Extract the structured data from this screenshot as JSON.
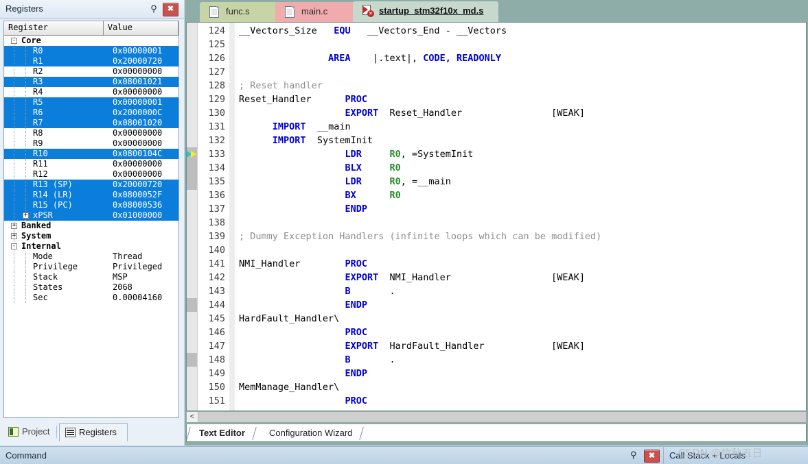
{
  "registers_panel": {
    "title": "Registers",
    "pin_icon": "pin-icon",
    "close_icon": "close-icon",
    "columns": [
      "Register",
      "Value"
    ],
    "rows": [
      {
        "level": 0,
        "toggle": "-",
        "name": "Core",
        "value": "",
        "selected": false,
        "bold": true
      },
      {
        "level": 1,
        "toggle": "",
        "name": "R0",
        "value": "0x00000001",
        "selected": true
      },
      {
        "level": 1,
        "toggle": "",
        "name": "R1",
        "value": "0x20000720",
        "selected": true
      },
      {
        "level": 1,
        "toggle": "",
        "name": "R2",
        "value": "0x00000000",
        "selected": false
      },
      {
        "level": 1,
        "toggle": "",
        "name": "R3",
        "value": "0x08001021",
        "selected": true
      },
      {
        "level": 1,
        "toggle": "",
        "name": "R4",
        "value": "0x00000000",
        "selected": false
      },
      {
        "level": 1,
        "toggle": "",
        "name": "R5",
        "value": "0x00000001",
        "selected": true
      },
      {
        "level": 1,
        "toggle": "",
        "name": "R6",
        "value": "0x2000000C",
        "selected": true
      },
      {
        "level": 1,
        "toggle": "",
        "name": "R7",
        "value": "0x08001020",
        "selected": true
      },
      {
        "level": 1,
        "toggle": "",
        "name": "R8",
        "value": "0x00000000",
        "selected": false
      },
      {
        "level": 1,
        "toggle": "",
        "name": "R9",
        "value": "0x00000000",
        "selected": false
      },
      {
        "level": 1,
        "toggle": "",
        "name": "R10",
        "value": "0x0800104C",
        "selected": true
      },
      {
        "level": 1,
        "toggle": "",
        "name": "R11",
        "value": "0x00000000",
        "selected": false
      },
      {
        "level": 1,
        "toggle": "",
        "name": "R12",
        "value": "0x00000000",
        "selected": false
      },
      {
        "level": 1,
        "toggle": "",
        "name": "R13 (SP)",
        "value": "0x20000720",
        "selected": true
      },
      {
        "level": 1,
        "toggle": "",
        "name": "R14 (LR)",
        "value": "0x0800052F",
        "selected": true
      },
      {
        "level": 1,
        "toggle": "",
        "name": "R15 (PC)",
        "value": "0x08000536",
        "selected": true
      },
      {
        "level": 1,
        "toggle": "+",
        "name": "xPSR",
        "value": "0x01000000",
        "selected": true
      },
      {
        "level": 0,
        "toggle": "+",
        "name": "Banked",
        "value": "",
        "selected": false
      },
      {
        "level": 0,
        "toggle": "+",
        "name": "System",
        "value": "",
        "selected": false
      },
      {
        "level": 0,
        "toggle": "-",
        "name": "Internal",
        "value": "",
        "selected": false
      },
      {
        "level": 1,
        "toggle": "",
        "name": "Mode",
        "value": "Thread",
        "selected": false
      },
      {
        "level": 1,
        "toggle": "",
        "name": "Privilege",
        "value": "Privileged",
        "selected": false
      },
      {
        "level": 1,
        "toggle": "",
        "name": "Stack",
        "value": "MSP",
        "selected": false
      },
      {
        "level": 1,
        "toggle": "",
        "name": "States",
        "value": "2068",
        "selected": false
      },
      {
        "level": 1,
        "toggle": "",
        "name": "Sec",
        "value": "0.00004160",
        "selected": false
      }
    ],
    "panel_tabs": [
      {
        "label": "Project",
        "icon": "project-icon",
        "active": false
      },
      {
        "label": "Registers",
        "icon": "registers-icon",
        "active": true
      }
    ]
  },
  "editor": {
    "tabs": [
      {
        "label": "func.s",
        "icon": "document-icon",
        "active": false,
        "color": "#c7d5a6"
      },
      {
        "label": "main.c",
        "icon": "document-icon",
        "active": false,
        "color": "#f0acac"
      },
      {
        "label": "startup_stm32f10x_md.s",
        "icon": "assembly-error-icon",
        "active": true,
        "color": "#c7d9cd"
      }
    ],
    "first_line_number": 124,
    "execution_line": 133,
    "lines": [
      {
        "n": "124",
        "segs": [
          {
            "t": "__Vectors_Size",
            "c": "id"
          },
          {
            "t": "   ",
            "c": "id"
          },
          {
            "t": "EQU",
            "c": "kw"
          },
          {
            "t": "   __Vectors_End - __Vectors",
            "c": "id"
          }
        ]
      },
      {
        "n": "125",
        "segs": []
      },
      {
        "n": "126",
        "segs": [
          {
            "t": "                ",
            "c": "id"
          },
          {
            "t": "AREA",
            "c": "kw"
          },
          {
            "t": "    |.text|, ",
            "c": "id"
          },
          {
            "t": "CODE, READONLY",
            "c": "kw"
          }
        ]
      },
      {
        "n": "127",
        "segs": []
      },
      {
        "n": "128",
        "segs": [
          {
            "t": "; Reset handler",
            "c": "cm"
          }
        ]
      },
      {
        "n": "129",
        "segs": [
          {
            "t": "Reset_Handler",
            "c": "id"
          },
          {
            "t": "      ",
            "c": "id"
          },
          {
            "t": "PROC",
            "c": "kw"
          }
        ]
      },
      {
        "n": "130",
        "segs": [
          {
            "t": "                   ",
            "c": "id"
          },
          {
            "t": "EXPORT",
            "c": "kw"
          },
          {
            "t": "  Reset_Handler                [WEAK]",
            "c": "id"
          }
        ]
      },
      {
        "n": "131",
        "segs": [
          {
            "t": "      ",
            "c": "id"
          },
          {
            "t": "IMPORT",
            "c": "kw"
          },
          {
            "t": "  __main",
            "c": "id"
          }
        ]
      },
      {
        "n": "132",
        "segs": [
          {
            "t": "      ",
            "c": "id"
          },
          {
            "t": "IMPORT",
            "c": "kw"
          },
          {
            "t": "  SystemInit",
            "c": "id"
          }
        ]
      },
      {
        "n": "133",
        "segs": [
          {
            "t": "                   ",
            "c": "id"
          },
          {
            "t": "LDR",
            "c": "kw"
          },
          {
            "t": "     ",
            "c": "id"
          },
          {
            "t": "R0",
            "c": "reg"
          },
          {
            "t": ", =SystemInit",
            "c": "id"
          }
        ]
      },
      {
        "n": "134",
        "segs": [
          {
            "t": "                   ",
            "c": "id"
          },
          {
            "t": "BLX",
            "c": "kw"
          },
          {
            "t": "     ",
            "c": "id"
          },
          {
            "t": "R0",
            "c": "reg"
          }
        ]
      },
      {
        "n": "135",
        "segs": [
          {
            "t": "                   ",
            "c": "id"
          },
          {
            "t": "LDR",
            "c": "kw"
          },
          {
            "t": "     ",
            "c": "id"
          },
          {
            "t": "R0",
            "c": "reg"
          },
          {
            "t": ", =__main",
            "c": "id"
          }
        ]
      },
      {
        "n": "136",
        "segs": [
          {
            "t": "                   ",
            "c": "id"
          },
          {
            "t": "BX",
            "c": "kw"
          },
          {
            "t": "      ",
            "c": "id"
          },
          {
            "t": "R0",
            "c": "reg"
          }
        ]
      },
      {
        "n": "137",
        "segs": [
          {
            "t": "                   ",
            "c": "id"
          },
          {
            "t": "ENDP",
            "c": "kw"
          }
        ]
      },
      {
        "n": "138",
        "segs": []
      },
      {
        "n": "139",
        "segs": [
          {
            "t": "; Dummy Exception Handlers (infinite loops which can be modified)",
            "c": "cm"
          }
        ]
      },
      {
        "n": "140",
        "segs": []
      },
      {
        "n": "141",
        "segs": [
          {
            "t": "NMI_Handler",
            "c": "id"
          },
          {
            "t": "        ",
            "c": "id"
          },
          {
            "t": "PROC",
            "c": "kw"
          }
        ]
      },
      {
        "n": "142",
        "segs": [
          {
            "t": "                   ",
            "c": "id"
          },
          {
            "t": "EXPORT",
            "c": "kw"
          },
          {
            "t": "  NMI_Handler                  [WEAK]",
            "c": "id"
          }
        ]
      },
      {
        "n": "143",
        "segs": [
          {
            "t": "                   ",
            "c": "id"
          },
          {
            "t": "B",
            "c": "kw"
          },
          {
            "t": "       .",
            "c": "id"
          }
        ]
      },
      {
        "n": "144",
        "segs": [
          {
            "t": "                   ",
            "c": "id"
          },
          {
            "t": "ENDP",
            "c": "kw"
          }
        ]
      },
      {
        "n": "145",
        "segs": [
          {
            "t": "HardFault_Handler\\",
            "c": "id"
          }
        ]
      },
      {
        "n": "146",
        "segs": [
          {
            "t": "                   ",
            "c": "id"
          },
          {
            "t": "PROC",
            "c": "kw"
          }
        ]
      },
      {
        "n": "147",
        "segs": [
          {
            "t": "                   ",
            "c": "id"
          },
          {
            "t": "EXPORT",
            "c": "kw"
          },
          {
            "t": "  HardFault_Handler            [WEAK]",
            "c": "id"
          }
        ]
      },
      {
        "n": "148",
        "segs": [
          {
            "t": "                   ",
            "c": "id"
          },
          {
            "t": "B",
            "c": "kw"
          },
          {
            "t": "       .",
            "c": "id"
          }
        ]
      },
      {
        "n": "149",
        "segs": [
          {
            "t": "                   ",
            "c": "id"
          },
          {
            "t": "ENDP",
            "c": "kw"
          }
        ]
      },
      {
        "n": "150",
        "segs": [
          {
            "t": "MemManage_Handler\\",
            "c": "id"
          }
        ]
      },
      {
        "n": "151",
        "segs": [
          {
            "t": "                   ",
            "c": "id"
          },
          {
            "t": "PROC",
            "c": "kw"
          }
        ]
      }
    ],
    "scroll_left_label": "<",
    "bottom_tabs": [
      {
        "label": "Text Editor",
        "active": true
      },
      {
        "label": "Configuration Wizard",
        "active": false
      }
    ]
  },
  "bottom_bar": {
    "command_label": "Command",
    "pin_icon": "pin-icon",
    "close_icon": "close-icon",
    "call_stack_label": "Call Stack + Locals"
  },
  "watermark": {
    "text": "CSDN @竹秋五日"
  },
  "colors": {
    "selection_blue": "#0b7ddb",
    "keyword_blue": "#0000d8",
    "comment_gray": "#8d8d8d",
    "register_green": "#2a8a2a",
    "close_red": "#c9524f"
  }
}
